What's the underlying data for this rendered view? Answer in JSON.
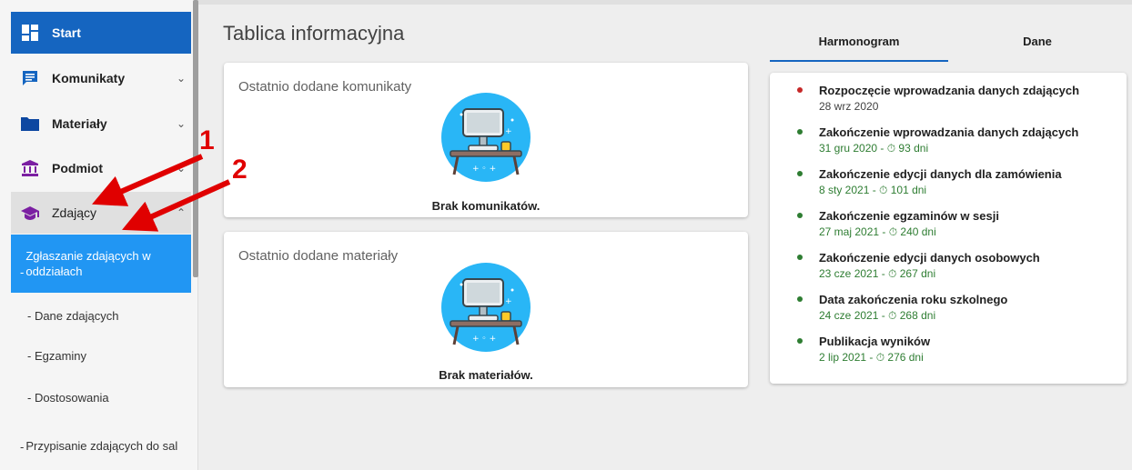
{
  "sidebar": {
    "items": [
      {
        "label": "Start",
        "icon": "dashboard-icon"
      },
      {
        "label": "Komunikaty",
        "icon": "message-icon"
      },
      {
        "label": "Materiały",
        "icon": "folder-icon"
      },
      {
        "label": "Podmiot",
        "icon": "institution-icon"
      },
      {
        "label": "Zdający",
        "icon": "graduation-cap-icon"
      }
    ],
    "subitems": [
      {
        "label": "Zgłaszanie zdających w oddziałach"
      },
      {
        "label": "- Dane zdających"
      },
      {
        "label": "- Egzaminy"
      },
      {
        "label": "- Dostosowania"
      },
      {
        "label": "Przypisanie zdających do sal"
      }
    ]
  },
  "main": {
    "title": "Tablica informacyjna",
    "cards": [
      {
        "title": "Ostatnio dodane komunikaty",
        "empty": "Brak komunikatów."
      },
      {
        "title": "Ostatnio dodane materiały",
        "empty": "Brak materiałów."
      }
    ]
  },
  "tabs": [
    {
      "label": "Harmonogram"
    },
    {
      "label": "Dane"
    }
  ],
  "schedule": [
    {
      "title": "Rozpoczęcie wprowadzania danych zdających",
      "sub": "28 wrz 2020",
      "status": "past"
    },
    {
      "title": "Zakończenie wprowadzania danych zdających",
      "sub": "31 gru 2020 - ⏱ 93 dni",
      "status": "upcoming"
    },
    {
      "title": "Zakończenie edycji danych dla zamówienia",
      "sub": "8 sty 2021 - ⏱ 101 dni",
      "status": "upcoming"
    },
    {
      "title": "Zakończenie egzaminów w sesji",
      "sub": "27 maj 2021 - ⏱ 240 dni",
      "status": "upcoming"
    },
    {
      "title": "Zakończenie edycji danych osobowych",
      "sub": "23 cze 2021 - ⏱ 267 dni",
      "status": "upcoming"
    },
    {
      "title": "Data zakończenia roku szkolnego",
      "sub": "24 cze 2021 - ⏱ 268 dni",
      "status": "upcoming"
    },
    {
      "title": "Publikacja wyników",
      "sub": "2 lip 2021 - ⏱ 276 dni",
      "status": "upcoming"
    }
  ],
  "annotations": [
    "1",
    "2"
  ],
  "colors": {
    "primary": "#1565c0",
    "active_sub": "#2196f3",
    "dot_red": "#c62828",
    "dot_green": "#2e7d32",
    "annotation": "#e00000"
  }
}
